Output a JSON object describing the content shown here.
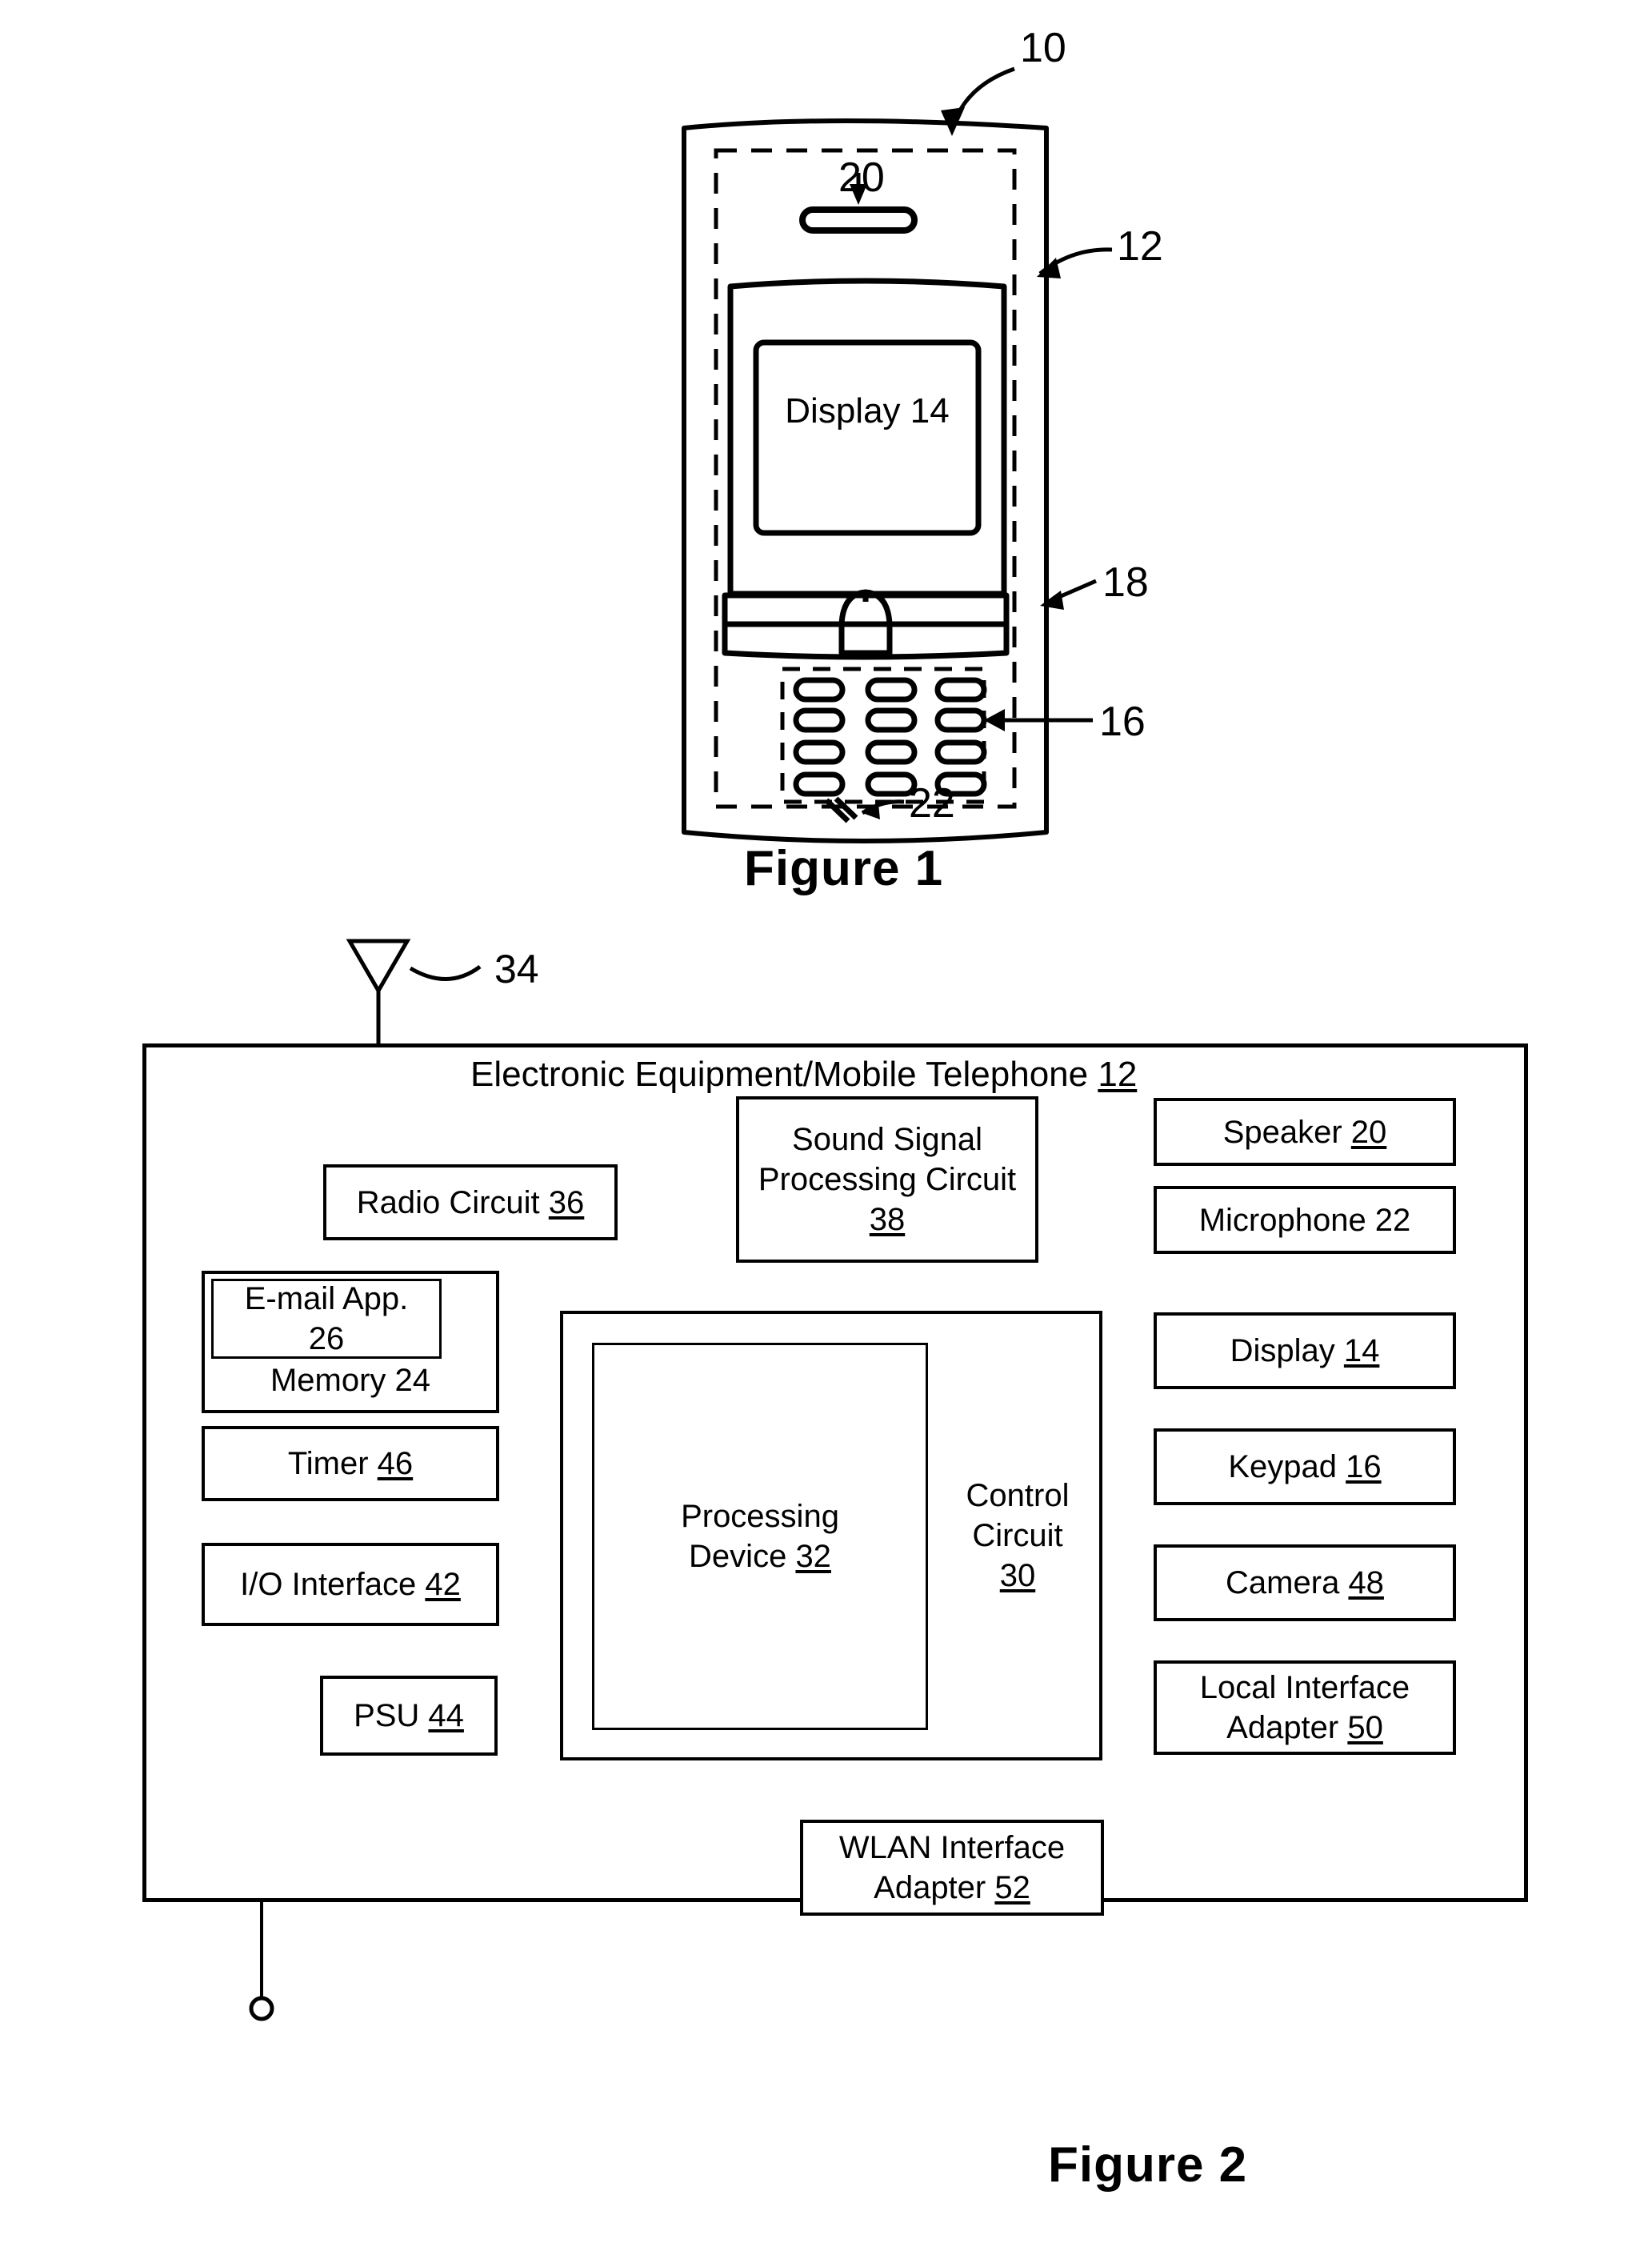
{
  "figure1": {
    "caption": "Figure 1",
    "display_label": "Display",
    "display_number": "14",
    "refs": [
      {
        "id": "ref-10",
        "text": "10"
      },
      {
        "id": "ref-12",
        "text": "12"
      },
      {
        "id": "ref-18",
        "text": "18"
      },
      {
        "id": "ref-16",
        "text": "16"
      },
      {
        "id": "ref-20",
        "text": "20"
      },
      {
        "id": "ref-22",
        "text": "22"
      }
    ],
    "speaker_ref": "20",
    "microphone_ref": "22",
    "keypad_ref": "16",
    "navigation_ref": "18",
    "housing_ref": "12",
    "device_ref": "10"
  },
  "figure2": {
    "caption": "Figure 2",
    "antenna_ref": "34",
    "title_text": "Electronic Equipment/Mobile Telephone ",
    "title_number": "12",
    "blocks": {
      "radio_circuit": {
        "label": "Radio Circuit ",
        "number": "36"
      },
      "sound_signal": {
        "line1": "Sound Signal",
        "line2": "Processing Circuit",
        "number": "38"
      },
      "speaker": {
        "label": "Speaker ",
        "number": "20"
      },
      "microphone": {
        "label": "Microphone 22",
        "number": ""
      },
      "email_app": {
        "line1": "E-mail App.",
        "line2": "26"
      },
      "memory": {
        "label": "Memory 24"
      },
      "timer": {
        "label": "Timer ",
        "number": "46"
      },
      "io_interface": {
        "label": "I/O Interface ",
        "number": "42"
      },
      "psu": {
        "label": "PSU ",
        "number": "44"
      },
      "processing_device": {
        "line1": "Processing",
        "line2": "Device ",
        "number": "32"
      },
      "control_circuit": {
        "line1": "Control",
        "line2": "Circuit",
        "number": "30"
      },
      "display": {
        "label": "Display ",
        "number": "14"
      },
      "keypad": {
        "label": "Keypad ",
        "number": "16"
      },
      "camera": {
        "label": "Camera ",
        "number": "48"
      },
      "local_interface": {
        "line1": "Local Interface",
        "line2": "Adapter ",
        "number": "50"
      },
      "wlan_interface": {
        "line1": "WLAN Interface",
        "line2": "Adapter ",
        "number": "52"
      }
    }
  },
  "colors": {
    "ink": "#000000",
    "paper": "#ffffff"
  }
}
